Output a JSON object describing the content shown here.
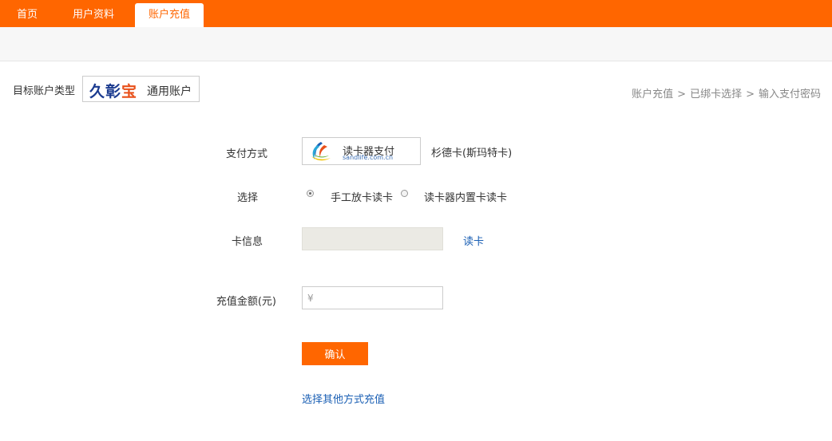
{
  "nav": {
    "tabs": [
      {
        "label": "首页",
        "active": false
      },
      {
        "label": "用户资料",
        "active": false
      },
      {
        "label": "账户充值",
        "active": true
      }
    ]
  },
  "account": {
    "type_label": "目标账户类型",
    "brand": [
      "久",
      "彰",
      "宝"
    ],
    "type_text": "通用账户"
  },
  "breadcrumb": {
    "steps": [
      "账户充值",
      "已绑卡选择",
      "输入支付密码"
    ],
    "separator": ">"
  },
  "form": {
    "payment_label": "支付方式",
    "payment_title": "读卡器支付",
    "payment_sub": "sandlife.com.cn",
    "payment_desc": "杉德卡(斯玛特卡)",
    "choose_label": "选择",
    "radio_options": [
      {
        "label": "手工放卡读卡",
        "checked": true
      },
      {
        "label": "读卡器内置卡读卡",
        "checked": false
      }
    ],
    "card_info_label": "卡信息",
    "read_card_link": "读卡",
    "amount_label": "充值金额(元)",
    "amount_prefix": "¥",
    "amount_value": "",
    "confirm_label": "确认",
    "other_method_link": "选择其他方式充值"
  },
  "colors": {
    "accent": "#ff6600",
    "link": "#1a5fb4",
    "card_field": "#ebeae4"
  }
}
